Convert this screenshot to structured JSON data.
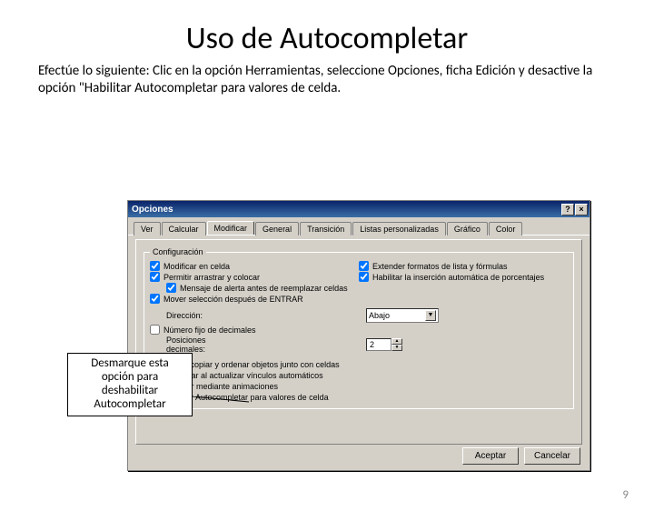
{
  "slide": {
    "title": "Uso de Autocompletar",
    "description": "Efectúe lo siguiente: Clic en la opción Herramientas, seleccione Opciones, ficha Edición y desactive la opción \"Habilitar Autocompletar para valores de celda.",
    "page_number": "9"
  },
  "callout": {
    "text": "Desmarque esta opción para deshabilitar Autocompletar"
  },
  "dialog": {
    "title": "Opciones",
    "titlebar_help": "?",
    "titlebar_close": "×",
    "tabs": [
      "Ver",
      "Calcular",
      "Modificar",
      "General",
      "Transición",
      "Listas personalizadas",
      "Gráfico",
      "Color"
    ],
    "active_tab_index": 2,
    "group_label": "Configuración",
    "options_left": [
      {
        "checked": true,
        "label": "Modificar en celda"
      },
      {
        "checked": true,
        "label": "Permitir arrastrar y colocar"
      },
      {
        "checked": true,
        "label": "Mensaje de alerta antes de reemplazar celdas",
        "indent": true
      },
      {
        "checked": true,
        "label": "Mover selección después de ENTRAR"
      }
    ],
    "options_right": [
      {
        "checked": true,
        "label": "Extender formatos de lista y fórmulas"
      },
      {
        "checked": true,
        "label": "Habilitar la inserción automática de porcentajes"
      }
    ],
    "direction_label": "Dirección:",
    "direction_value": "Abajo",
    "fixed_decimals": {
      "checked": false,
      "label": "Número fijo de decimales"
    },
    "decimal_pos_label": "Posiciones decimales:",
    "decimal_pos_value": "2",
    "options_bottom": [
      {
        "checked": true,
        "label": "Cortar, copiar y ordenar objetos junto con celdas"
      },
      {
        "checked": true,
        "label": "Consultar al actualizar vínculos automáticos"
      },
      {
        "checked": true,
        "label": "Informar mediante animaciones"
      },
      {
        "checked": true,
        "label": "Habilitar Autocompletar para valores de celda"
      }
    ],
    "buttons": {
      "ok": "Aceptar",
      "cancel": "Cancelar"
    }
  }
}
